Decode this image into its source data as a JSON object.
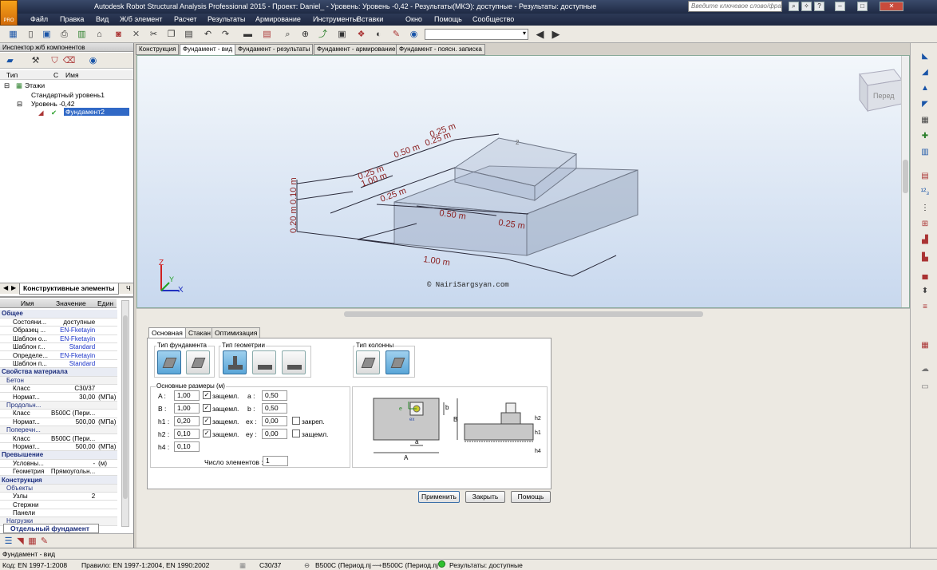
{
  "window": {
    "title": "Autodesk Robot Structural Analysis Professional 2015 - Проект: Daniel_ - Уровень: Уровень -0,42 - Результаты(МКЭ): доступные - Результаты: доступные",
    "app_badge": "PRO",
    "search_placeholder": "Введите ключевое слово/фразу",
    "ctrl_min": "–",
    "ctrl_max": "□",
    "ctrl_close": "✕"
  },
  "menu": [
    "Файл",
    "Правка",
    "Вид",
    "Ж/б элемент",
    "Расчет",
    "Результаты",
    "Армирование",
    "Инструменты",
    "Вставки",
    "Окно",
    "Помощь",
    "Сообщество"
  ],
  "inspector": {
    "title": "Инспектор ж/б компонентов",
    "col_type": "Тип",
    "col_c": "С",
    "col_name": "Имя",
    "tree": [
      "Этажи",
      "Стандартный уровень1",
      "Уровень -0,42",
      "Фундамент2"
    ],
    "bottom_tab": "Конструктивные элементы",
    "bottom_tab2": "Ч"
  },
  "props": {
    "col_name": "Имя",
    "col_value": "Значение",
    "col_unit": "Един",
    "rows": [
      {
        "k": "Общее",
        "g": 1
      },
      {
        "k": "Состояни...",
        "v": "доступные"
      },
      {
        "k": "Образец ...",
        "v": "EN-Fketayin",
        "b": 1
      },
      {
        "k": "Шаблон о...",
        "v": "EN-Fketayin",
        "b": 1
      },
      {
        "k": "Шаблон г...",
        "v": "Standard",
        "b": 1
      },
      {
        "k": "Определе...",
        "v": "EN-Fketayin",
        "b": 1
      },
      {
        "k": "Шаблон п...",
        "v": "Standard",
        "b": 1
      },
      {
        "k": "Свойства материала",
        "g": 1
      },
      {
        "k": "Бетон",
        "s": 1
      },
      {
        "k": "Класс",
        "v": "C30/37"
      },
      {
        "k": "Нормат...",
        "v": "30,00",
        "u": "(МПа)"
      },
      {
        "k": "Продольн...",
        "s": 1
      },
      {
        "k": "Класс",
        "v": "B500C (Пери..."
      },
      {
        "k": "Нормат...",
        "v": "500,00",
        "u": "(МПа)"
      },
      {
        "k": "Поперечн...",
        "s": 1
      },
      {
        "k": "Класс",
        "v": "B500C (Пери..."
      },
      {
        "k": "Нормат...",
        "v": "500,00",
        "u": "(МПа)"
      },
      {
        "k": "Превышение",
        "g": 1
      },
      {
        "k": "Условны...",
        "v": "-",
        "u": "(м)"
      },
      {
        "k": "Геометрия",
        "v": "Прямоугольн..."
      },
      {
        "k": "Конструкция",
        "g": 1
      },
      {
        "k": "Объекты",
        "s": 1
      },
      {
        "k": "Узлы",
        "v": "2"
      },
      {
        "k": "Стержни",
        "v": ""
      },
      {
        "k": "Панели",
        "v": ""
      },
      {
        "k": "Нагрузки",
        "s": 1
      }
    ],
    "footer_tab": "Отдельный фундамент"
  },
  "view_tabs": [
    "Конструкция",
    "Фундамент - вид",
    "Фундамент - результаты",
    "Фундамент - армирование",
    "Фундамент - поясн. записка"
  ],
  "viewport": {
    "dims": [
      "0.25 m",
      "0.50 m",
      "0.25 m",
      "0.25 m",
      "1.00 m",
      "0.25 m",
      "0.50 m",
      "0.25 m",
      "1.00 m",
      "0.10 m",
      "0.20 m"
    ],
    "node_label": "2",
    "copyright": "© NairiSargsyan.com",
    "cube_label": "Перед",
    "axis_z": "Z",
    "axis_y": "Y",
    "axis_x": "X"
  },
  "dialog": {
    "tabs": [
      "Основная",
      "Стакан",
      "Оптимизация"
    ],
    "foundation_type_label": "Тип фундамента",
    "geometry_type_label": "Тип геометрии",
    "column_type_label": "Тип колонны",
    "main_dims_label": "Основные размеры (м)",
    "fields": [
      {
        "l": "A :",
        "v": "1,00",
        "c": "защемл."
      },
      {
        "l": "B :",
        "v": "1,00",
        "c": "защемл."
      },
      {
        "l": "h1 :",
        "v": "0,20",
        "c": "защемл."
      },
      {
        "l": "h2 :",
        "v": "0,10",
        "c": "защемл."
      },
      {
        "l": "h4 :",
        "v": "0,10"
      }
    ],
    "fields2": [
      {
        "l": "a :",
        "v": "0,50"
      },
      {
        "l": "b :",
        "v": "0,50"
      },
      {
        "l": "ex :",
        "v": "0,00",
        "c": "закреп."
      },
      {
        "l": "ey :",
        "v": "0,00",
        "c": "защемл."
      }
    ],
    "count_label": "Число элементов :",
    "count_value": "1",
    "diagram": {
      "A": "A",
      "B": "B",
      "a": "a",
      "b": "b",
      "e": "e",
      "ex": "ex",
      "h1": "h1",
      "h2": "h2",
      "h4": "h4"
    },
    "buttons": [
      "Применить",
      "Закрыть",
      "Помощь"
    ]
  },
  "statusbar": {
    "view": "Фундамент - вид",
    "code": "Код: EN 1997-1:2008",
    "rule": "Правило: EN 1997-1:2004, EN 1990:2002",
    "concrete": "C30/37",
    "steel1": "B500C (Период.пј",
    "steel2": "B500C (Период.пј",
    "results": "Результаты: доступные"
  }
}
